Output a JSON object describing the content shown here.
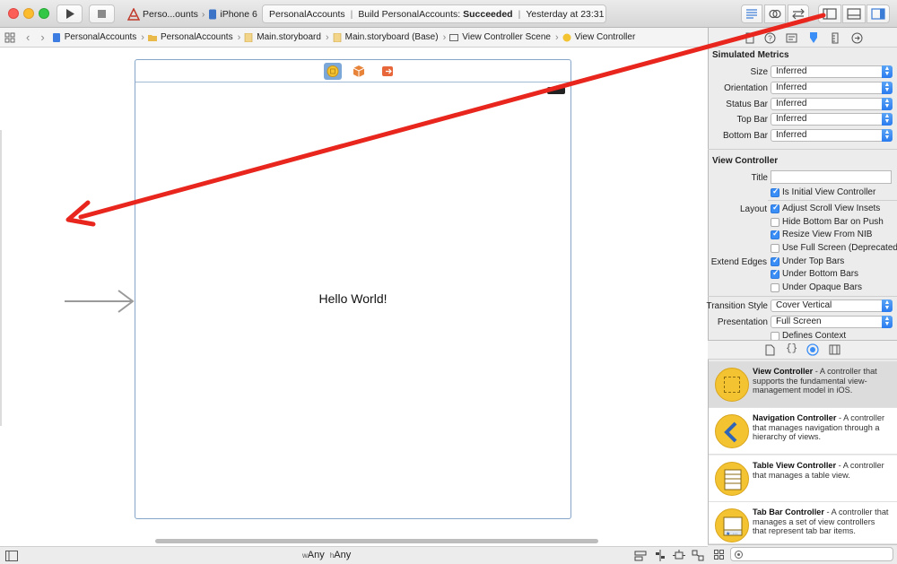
{
  "toolbar": {
    "scheme_name": "Perso...ounts",
    "scheme_separator": "›",
    "destination": "iPhone 6",
    "activity_project": "PersonalAccounts",
    "activity_build_prefix": "Build PersonalAccounts:",
    "activity_build_status": "Succeeded",
    "activity_time": "Yesterday at 23:31"
  },
  "jumpbar": {
    "items": [
      {
        "label": "PersonalAccounts",
        "icon": "project-icon"
      },
      {
        "label": "PersonalAccounts",
        "icon": "folder-icon"
      },
      {
        "label": "Main.storyboard",
        "icon": "storyboard-file-icon"
      },
      {
        "label": "Main.storyboard (Base)",
        "icon": "storyboard-file-icon"
      },
      {
        "label": "View Controller Scene",
        "icon": "scene-icon"
      },
      {
        "label": "View Controller",
        "icon": "view-controller-icon"
      }
    ]
  },
  "canvas": {
    "hello_label": "Hello World!",
    "size_class_w_prefix": "w",
    "size_class_w": "Any",
    "size_class_h_prefix": "h",
    "size_class_h": "Any"
  },
  "inspector": {
    "simulated_metrics_title": "Simulated Metrics",
    "metrics": [
      {
        "label": "Size",
        "value": "Inferred"
      },
      {
        "label": "Orientation",
        "value": "Inferred"
      },
      {
        "label": "Status Bar",
        "value": "Inferred"
      },
      {
        "label": "Top Bar",
        "value": "Inferred"
      },
      {
        "label": "Bottom Bar",
        "value": "Inferred"
      }
    ],
    "view_controller_title": "View Controller",
    "title_label": "Title",
    "title_value": "",
    "initial_vc_label": "Is Initial View Controller",
    "layout_label": "Layout",
    "layout_options": [
      {
        "label": "Adjust Scroll View Insets",
        "checked": true
      },
      {
        "label": "Hide Bottom Bar on Push",
        "checked": false
      },
      {
        "label": "Resize View From NIB",
        "checked": true
      },
      {
        "label": "Use Full Screen (Deprecated)",
        "checked": false
      }
    ],
    "extend_edges_label": "Extend Edges",
    "extend_options": [
      {
        "label": "Under Top Bars",
        "checked": true
      },
      {
        "label": "Under Bottom Bars",
        "checked": true
      },
      {
        "label": "Under Opaque Bars",
        "checked": false
      }
    ],
    "transition_style_label": "Transition Style",
    "transition_style_value": "Cover Vertical",
    "presentation_label": "Presentation",
    "presentation_value": "Full Screen",
    "defines_context_label": "Defines Context"
  },
  "library": {
    "items": [
      {
        "name": "View Controller",
        "desc": " - A controller that supports the fundamental view-management model in iOS."
      },
      {
        "name": "Navigation Controller",
        "desc": " - A controller that manages navigation through a hierarchy of views."
      },
      {
        "name": "Table View Controller",
        "desc": " - A controller that manages a table view."
      },
      {
        "name": "Tab Bar Controller",
        "desc": " - A controller that manages a set of view controllers that represent tab bar items."
      }
    ]
  },
  "colors": {
    "accent": "#3a8ef5",
    "annotation_arrow": "#e8261d",
    "scene_border": "#85a6c9"
  }
}
